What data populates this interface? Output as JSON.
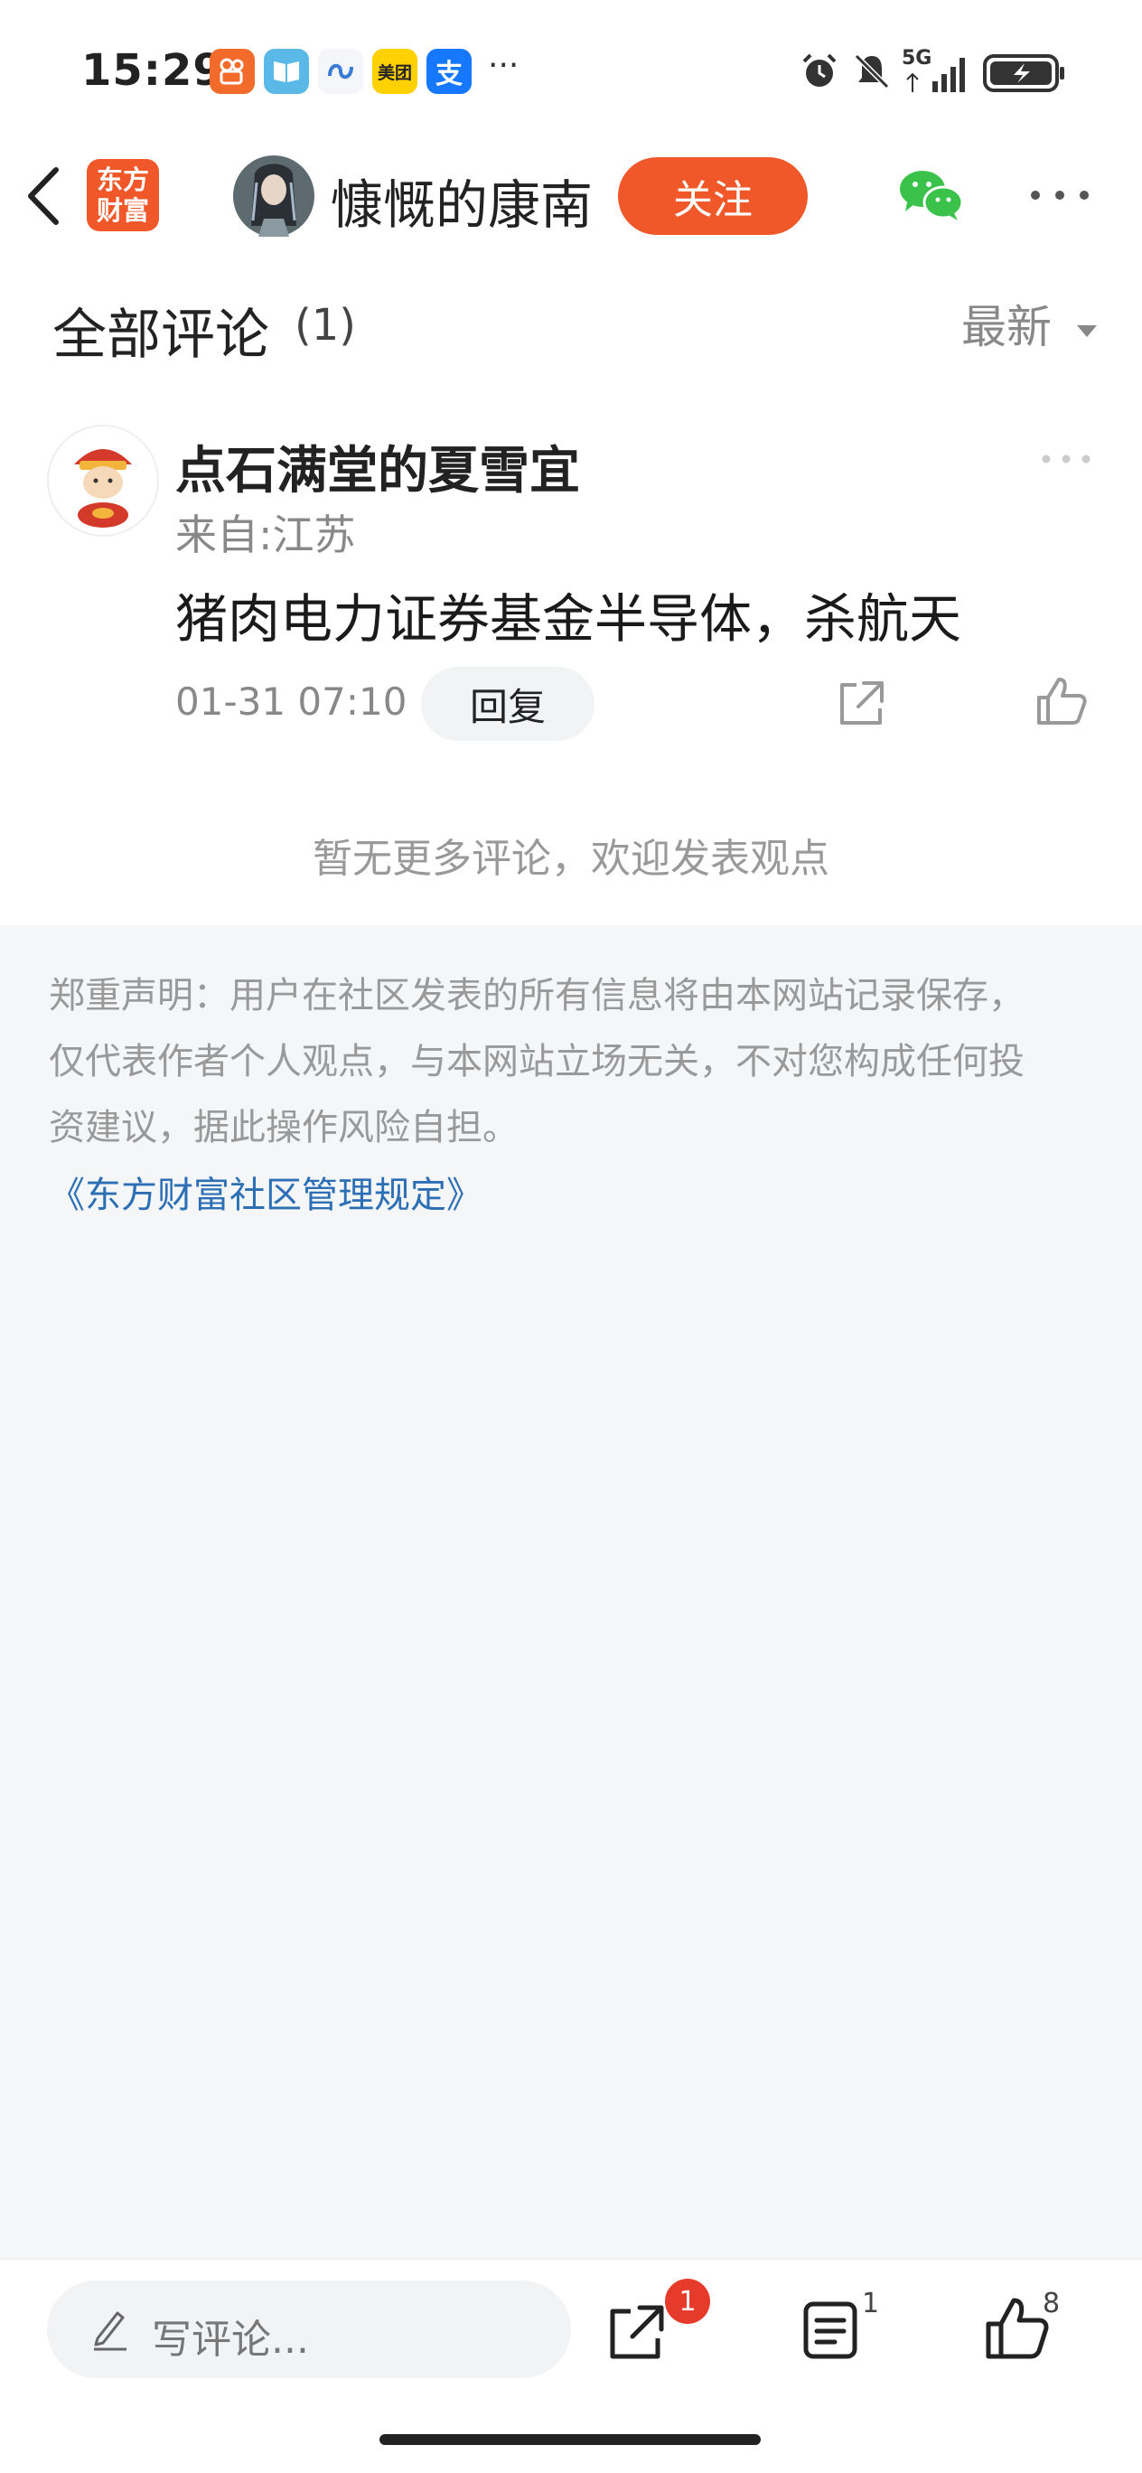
{
  "status_bar": {
    "time": "15:29",
    "network": "5G",
    "app_icons": [
      "kuaishou-icon",
      "reader-icon",
      "swirl-app-icon",
      "meituan-icon",
      "alipay-icon"
    ],
    "meituan_label": "美团",
    "alipay_label": "支"
  },
  "nav": {
    "logo_line1": "东方",
    "logo_line2": "财富",
    "author": "慷慨的康南",
    "follow_label": "关注"
  },
  "section": {
    "title": "全部评论",
    "count": "(1)",
    "sort_label": "最新"
  },
  "comment": {
    "user": "点石满堂的夏雪宜",
    "location": "来自:江苏",
    "text": "猪肉电力证券基金半导体，杀航天",
    "time": "01-31 07:10",
    "reply_label": "回复"
  },
  "no_more_text": "暂无更多评论，欢迎发表观点",
  "disclaimer": {
    "line1": "郑重声明：用户在社区发表的所有信息将由本网站记录保存，",
    "line2": "仅代表作者个人观点，与本网站立场无关，不对您构成任何投",
    "line3": "资建议，据此操作风险自担。",
    "rules_link": "《东方财富社区管理规定》"
  },
  "bottom_bar": {
    "comment_placeholder": "写评论...",
    "share_badge": "1",
    "comments_count": "1",
    "likes_count": "8"
  },
  "colors": {
    "accent": "#f0582a",
    "link": "#2c6fb5",
    "badge": "#e63a2b",
    "wechat": "#3bc24a"
  }
}
